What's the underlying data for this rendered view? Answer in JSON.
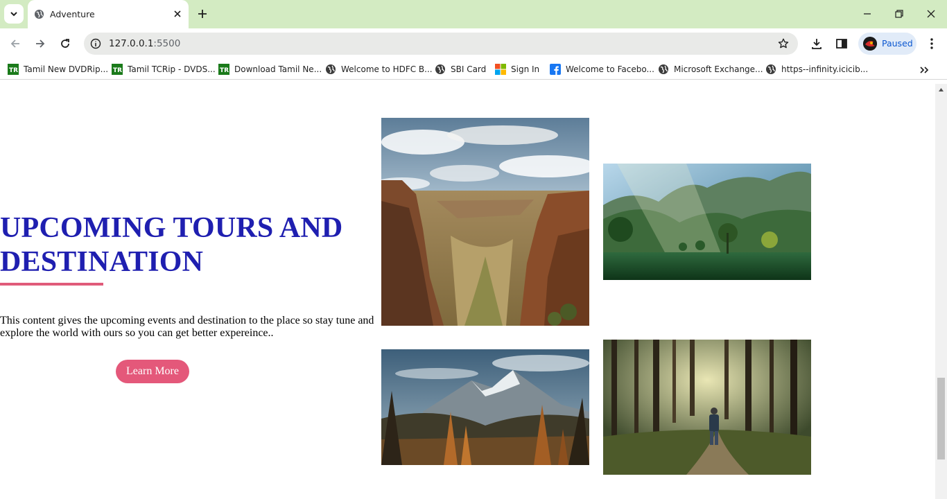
{
  "browser": {
    "tab_title": "Adventure",
    "url_host": "127.0.0.1",
    "url_port": ":5500",
    "profile_label": "Paused",
    "bookmarks": [
      {
        "label": "Tamil New DVDRip...",
        "icon": "tr-icon"
      },
      {
        "label": "Tamil TCRip - DVDS...",
        "icon": "tr-icon"
      },
      {
        "label": "Download Tamil Ne...",
        "icon": "tr-icon"
      },
      {
        "label": "Welcome to HDFC B...",
        "icon": "globe-icon"
      },
      {
        "label": "SBI Card",
        "icon": "globe-icon"
      },
      {
        "label": "Sign In",
        "icon": "microsoft-icon"
      },
      {
        "label": "Welcome to Facebo...",
        "icon": "facebook-icon"
      },
      {
        "label": "Microsoft Exchange...",
        "icon": "globe-icon"
      },
      {
        "label": "https--infinity.icicib...",
        "icon": "globe-icon"
      }
    ]
  },
  "page": {
    "heading_line1": "UPCOMING TOURS AND",
    "heading_line2": "DESTINATION",
    "description": "This content gives the upcoming events and destination to the place so stay tune and explore the world with ours so you can get better expereince..",
    "learn_more": "Learn More",
    "photos": [
      "canyon-photo",
      "lake-mountain-photo",
      "autumn-mountain-photo",
      "forest-walker-photo"
    ]
  },
  "colors": {
    "tabbar_bg": "#d3ebc2",
    "heading": "#1f1fb0",
    "accent": "#e05b7a"
  }
}
